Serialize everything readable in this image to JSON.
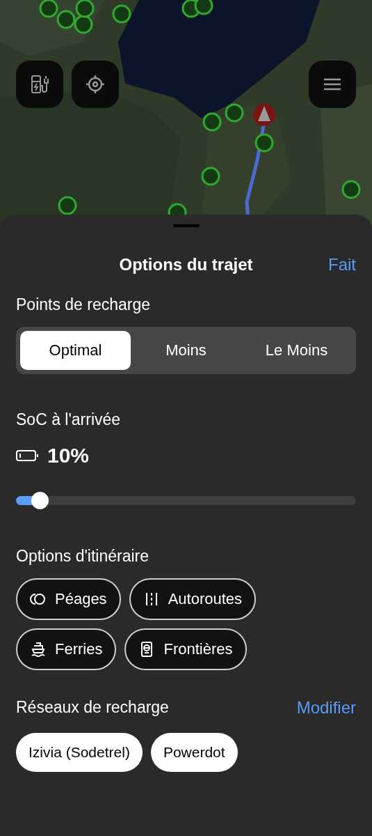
{
  "sheet": {
    "title": "Options du trajet",
    "done": "Fait"
  },
  "charging_points": {
    "label": "Points de recharge",
    "options": [
      {
        "label": "Optimal",
        "selected": true
      },
      {
        "label": "Moins",
        "selected": false
      },
      {
        "label": "Le Moins",
        "selected": false
      }
    ]
  },
  "soc": {
    "label": "SoC à l'arrivée",
    "reading": "10%",
    "level": 0.07
  },
  "route_options": {
    "label": "Options d'itinéraire",
    "chips": [
      {
        "label": "Péages",
        "kind": "tolls"
      },
      {
        "label": "Autoroutes",
        "kind": "highways"
      },
      {
        "label": "Ferries",
        "kind": "ferries"
      },
      {
        "label": "Frontières",
        "kind": "borders"
      }
    ]
  },
  "networks": {
    "label": "Réseaux de recharge",
    "edit": "Modifier",
    "items": [
      "Izivia (Sodetrel)",
      "Powerdot"
    ]
  }
}
